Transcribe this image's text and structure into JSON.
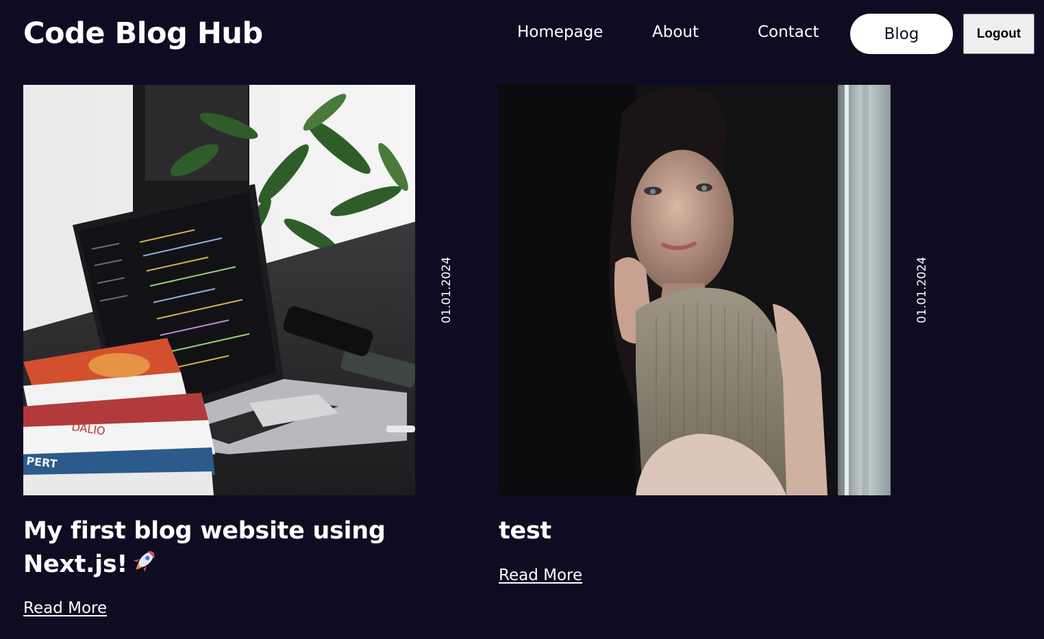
{
  "header": {
    "logo": "Code Blog Hub",
    "nav": {
      "homepage": "Homepage",
      "about": "About",
      "contact": "Contact",
      "blog": "Blog"
    },
    "logout": "Logout"
  },
  "posts": [
    {
      "title": "My first blog website using Next.js!",
      "emoji_icon": "rocket-icon",
      "date": "01.01.2024",
      "read_more": "Read More",
      "image": "laptop-with-code-and-books-photo"
    },
    {
      "title": "test",
      "date": "01.01.2024",
      "read_more": "Read More",
      "image": "woman-by-window-portrait-photo"
    }
  ],
  "colors": {
    "background": "#0e0c22",
    "text": "#ffffff",
    "active_pill": "#ffffff"
  }
}
